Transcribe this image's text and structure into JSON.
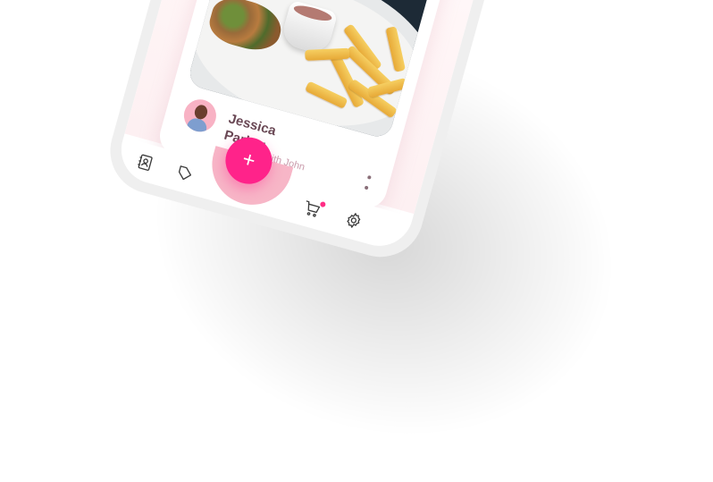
{
  "post": {
    "author_name": "Jessica Parker",
    "author_subtitle": "Photo with John"
  },
  "fab": {
    "label": "+"
  },
  "bottom_nav": {
    "items": [
      {
        "icon": "contacts-book-icon"
      },
      {
        "icon": "tag-icon"
      },
      {
        "icon": "cart-icon",
        "badge": true
      },
      {
        "icon": "gear-icon"
      }
    ]
  },
  "colors": {
    "accent": "#ff238a",
    "cradle": "#f7b6c7",
    "author_name": "#6a4855",
    "author_subtitle": "#c99aab"
  }
}
